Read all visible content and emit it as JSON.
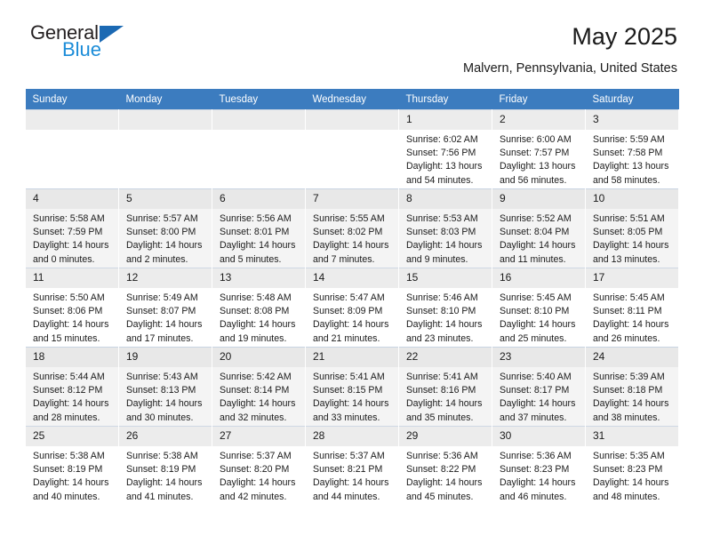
{
  "brand": {
    "name_top": "General",
    "name_bottom": "Blue",
    "mark": "triangle-logo",
    "color_dark": "#231f20",
    "color_blue": "#1b8cd8",
    "color_triangle": "#1b69b3"
  },
  "header": {
    "title": "May 2025",
    "subtitle": "Malvern, Pennsylvania, United States"
  },
  "theme": {
    "header_row_bg": "#3c7cbf",
    "header_row_fg": "#ffffff",
    "alt_row_bg": "#f4f4f4",
    "daynum_bg": "#ececec"
  },
  "weekdays": [
    "Sunday",
    "Monday",
    "Tuesday",
    "Wednesday",
    "Thursday",
    "Friday",
    "Saturday"
  ],
  "weeks": [
    [
      {
        "day": "",
        "sunrise": "",
        "sunset": "",
        "daylight1": "",
        "daylight2": ""
      },
      {
        "day": "",
        "sunrise": "",
        "sunset": "",
        "daylight1": "",
        "daylight2": ""
      },
      {
        "day": "",
        "sunrise": "",
        "sunset": "",
        "daylight1": "",
        "daylight2": ""
      },
      {
        "day": "",
        "sunrise": "",
        "sunset": "",
        "daylight1": "",
        "daylight2": ""
      },
      {
        "day": "1",
        "sunrise": "Sunrise: 6:02 AM",
        "sunset": "Sunset: 7:56 PM",
        "daylight1": "Daylight: 13 hours",
        "daylight2": "and 54 minutes."
      },
      {
        "day": "2",
        "sunrise": "Sunrise: 6:00 AM",
        "sunset": "Sunset: 7:57 PM",
        "daylight1": "Daylight: 13 hours",
        "daylight2": "and 56 minutes."
      },
      {
        "day": "3",
        "sunrise": "Sunrise: 5:59 AM",
        "sunset": "Sunset: 7:58 PM",
        "daylight1": "Daylight: 13 hours",
        "daylight2": "and 58 minutes."
      }
    ],
    [
      {
        "day": "4",
        "sunrise": "Sunrise: 5:58 AM",
        "sunset": "Sunset: 7:59 PM",
        "daylight1": "Daylight: 14 hours",
        "daylight2": "and 0 minutes."
      },
      {
        "day": "5",
        "sunrise": "Sunrise: 5:57 AM",
        "sunset": "Sunset: 8:00 PM",
        "daylight1": "Daylight: 14 hours",
        "daylight2": "and 2 minutes."
      },
      {
        "day": "6",
        "sunrise": "Sunrise: 5:56 AM",
        "sunset": "Sunset: 8:01 PM",
        "daylight1": "Daylight: 14 hours",
        "daylight2": "and 5 minutes."
      },
      {
        "day": "7",
        "sunrise": "Sunrise: 5:55 AM",
        "sunset": "Sunset: 8:02 PM",
        "daylight1": "Daylight: 14 hours",
        "daylight2": "and 7 minutes."
      },
      {
        "day": "8",
        "sunrise": "Sunrise: 5:53 AM",
        "sunset": "Sunset: 8:03 PM",
        "daylight1": "Daylight: 14 hours",
        "daylight2": "and 9 minutes."
      },
      {
        "day": "9",
        "sunrise": "Sunrise: 5:52 AM",
        "sunset": "Sunset: 8:04 PM",
        "daylight1": "Daylight: 14 hours",
        "daylight2": "and 11 minutes."
      },
      {
        "day": "10",
        "sunrise": "Sunrise: 5:51 AM",
        "sunset": "Sunset: 8:05 PM",
        "daylight1": "Daylight: 14 hours",
        "daylight2": "and 13 minutes."
      }
    ],
    [
      {
        "day": "11",
        "sunrise": "Sunrise: 5:50 AM",
        "sunset": "Sunset: 8:06 PM",
        "daylight1": "Daylight: 14 hours",
        "daylight2": "and 15 minutes."
      },
      {
        "day": "12",
        "sunrise": "Sunrise: 5:49 AM",
        "sunset": "Sunset: 8:07 PM",
        "daylight1": "Daylight: 14 hours",
        "daylight2": "and 17 minutes."
      },
      {
        "day": "13",
        "sunrise": "Sunrise: 5:48 AM",
        "sunset": "Sunset: 8:08 PM",
        "daylight1": "Daylight: 14 hours",
        "daylight2": "and 19 minutes."
      },
      {
        "day": "14",
        "sunrise": "Sunrise: 5:47 AM",
        "sunset": "Sunset: 8:09 PM",
        "daylight1": "Daylight: 14 hours",
        "daylight2": "and 21 minutes."
      },
      {
        "day": "15",
        "sunrise": "Sunrise: 5:46 AM",
        "sunset": "Sunset: 8:10 PM",
        "daylight1": "Daylight: 14 hours",
        "daylight2": "and 23 minutes."
      },
      {
        "day": "16",
        "sunrise": "Sunrise: 5:45 AM",
        "sunset": "Sunset: 8:10 PM",
        "daylight1": "Daylight: 14 hours",
        "daylight2": "and 25 minutes."
      },
      {
        "day": "17",
        "sunrise": "Sunrise: 5:45 AM",
        "sunset": "Sunset: 8:11 PM",
        "daylight1": "Daylight: 14 hours",
        "daylight2": "and 26 minutes."
      }
    ],
    [
      {
        "day": "18",
        "sunrise": "Sunrise: 5:44 AM",
        "sunset": "Sunset: 8:12 PM",
        "daylight1": "Daylight: 14 hours",
        "daylight2": "and 28 minutes."
      },
      {
        "day": "19",
        "sunrise": "Sunrise: 5:43 AM",
        "sunset": "Sunset: 8:13 PM",
        "daylight1": "Daylight: 14 hours",
        "daylight2": "and 30 minutes."
      },
      {
        "day": "20",
        "sunrise": "Sunrise: 5:42 AM",
        "sunset": "Sunset: 8:14 PM",
        "daylight1": "Daylight: 14 hours",
        "daylight2": "and 32 minutes."
      },
      {
        "day": "21",
        "sunrise": "Sunrise: 5:41 AM",
        "sunset": "Sunset: 8:15 PM",
        "daylight1": "Daylight: 14 hours",
        "daylight2": "and 33 minutes."
      },
      {
        "day": "22",
        "sunrise": "Sunrise: 5:41 AM",
        "sunset": "Sunset: 8:16 PM",
        "daylight1": "Daylight: 14 hours",
        "daylight2": "and 35 minutes."
      },
      {
        "day": "23",
        "sunrise": "Sunrise: 5:40 AM",
        "sunset": "Sunset: 8:17 PM",
        "daylight1": "Daylight: 14 hours",
        "daylight2": "and 37 minutes."
      },
      {
        "day": "24",
        "sunrise": "Sunrise: 5:39 AM",
        "sunset": "Sunset: 8:18 PM",
        "daylight1": "Daylight: 14 hours",
        "daylight2": "and 38 minutes."
      }
    ],
    [
      {
        "day": "25",
        "sunrise": "Sunrise: 5:38 AM",
        "sunset": "Sunset: 8:19 PM",
        "daylight1": "Daylight: 14 hours",
        "daylight2": "and 40 minutes."
      },
      {
        "day": "26",
        "sunrise": "Sunrise: 5:38 AM",
        "sunset": "Sunset: 8:19 PM",
        "daylight1": "Daylight: 14 hours",
        "daylight2": "and 41 minutes."
      },
      {
        "day": "27",
        "sunrise": "Sunrise: 5:37 AM",
        "sunset": "Sunset: 8:20 PM",
        "daylight1": "Daylight: 14 hours",
        "daylight2": "and 42 minutes."
      },
      {
        "day": "28",
        "sunrise": "Sunrise: 5:37 AM",
        "sunset": "Sunset: 8:21 PM",
        "daylight1": "Daylight: 14 hours",
        "daylight2": "and 44 minutes."
      },
      {
        "day": "29",
        "sunrise": "Sunrise: 5:36 AM",
        "sunset": "Sunset: 8:22 PM",
        "daylight1": "Daylight: 14 hours",
        "daylight2": "and 45 minutes."
      },
      {
        "day": "30",
        "sunrise": "Sunrise: 5:36 AM",
        "sunset": "Sunset: 8:23 PM",
        "daylight1": "Daylight: 14 hours",
        "daylight2": "and 46 minutes."
      },
      {
        "day": "31",
        "sunrise": "Sunrise: 5:35 AM",
        "sunset": "Sunset: 8:23 PM",
        "daylight1": "Daylight: 14 hours",
        "daylight2": "and 48 minutes."
      }
    ]
  ]
}
